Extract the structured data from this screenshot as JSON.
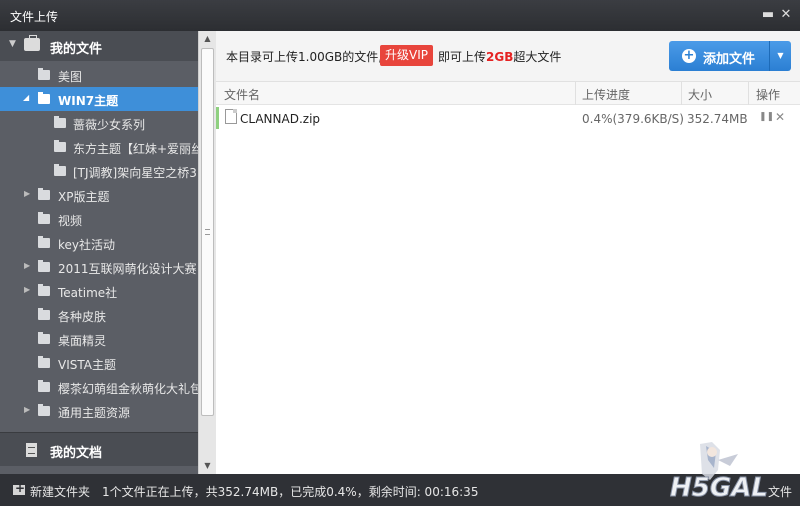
{
  "window": {
    "title": "文件上传"
  },
  "sidebar": {
    "header": "我的文件",
    "items": [
      {
        "label": "美图",
        "level": 1,
        "expandable": false,
        "selected": false
      },
      {
        "label": "WIN7主题",
        "level": 1,
        "expandable": true,
        "expanded": true,
        "selected": true
      },
      {
        "label": "蔷薇少女系列",
        "level": 2,
        "expandable": false,
        "selected": false
      },
      {
        "label": "东方主题【红妹+爱丽丝",
        "level": 2,
        "expandable": false,
        "selected": false
      },
      {
        "label": "[TJ调教]架向星空之桥3",
        "level": 2,
        "expandable": false,
        "selected": false
      },
      {
        "label": "XP版主题",
        "level": 1,
        "expandable": true,
        "selected": false
      },
      {
        "label": "视频",
        "level": 1,
        "expandable": false,
        "selected": false
      },
      {
        "label": "key社活动",
        "level": 1,
        "expandable": false,
        "selected": false
      },
      {
        "label": "2011互联网萌化设计大赛",
        "level": 1,
        "expandable": true,
        "selected": false
      },
      {
        "label": "Teatime社",
        "level": 1,
        "expandable": true,
        "selected": false
      },
      {
        "label": "各种皮肤",
        "level": 1,
        "expandable": false,
        "selected": false
      },
      {
        "label": "桌面精灵",
        "level": 1,
        "expandable": false,
        "selected": false
      },
      {
        "label": "VISTA主题",
        "level": 1,
        "expandable": false,
        "selected": false
      },
      {
        "label": "樱茶幻萌组金秋萌化大礼包",
        "level": 1,
        "expandable": false,
        "selected": false
      },
      {
        "label": "通用主题资源",
        "level": 1,
        "expandable": true,
        "selected": false
      }
    ],
    "footer_header": "我的文档"
  },
  "info_bar": {
    "text_before": "本目录可上传1.00GB的文件,",
    "vip_button": "升级VIP",
    "text_after_1": "即可上传",
    "text_highlight": "2GB",
    "text_after_2": "超大文件"
  },
  "add_button": {
    "label": "添加文件"
  },
  "table": {
    "headers": {
      "name": "文件名",
      "progress": "上传进度",
      "size": "大小",
      "action": "操作"
    },
    "rows": [
      {
        "name": "CLANNAD.zip",
        "progress": "0.4%(379.6KB/S)",
        "size": "352.74MB"
      }
    ]
  },
  "status_bar": {
    "new_folder": "新建文件夹",
    "message": "1个文件正在上传，共352.74MB，已完成0.4%，剩余时间: 00:16:35",
    "right_text": "文件"
  },
  "watermark": {
    "text": "H5GAL"
  },
  "colors": {
    "accent": "#3e8fd9",
    "vip": "#e8453c",
    "highlight": "#e52222"
  }
}
